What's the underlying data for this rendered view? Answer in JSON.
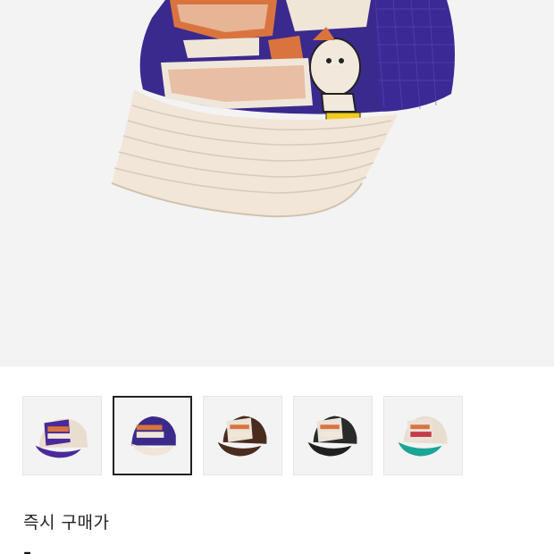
{
  "product": {
    "hero_image": "trucker-cap-purple-cream-graffiti",
    "price_label": "즉시 구매가",
    "price_value": "-"
  },
  "thumbnails": [
    {
      "name": "purple-cream-cap",
      "crown": "#4a2a9a",
      "front": "#e9ddd0",
      "brim": "#4a2a9a",
      "selected": false
    },
    {
      "name": "navy-cream-cap",
      "crown": "#3b2a8a",
      "front": "#e9ddd0",
      "brim": "#efe5d8",
      "selected": true
    },
    {
      "name": "brown-cap",
      "crown": "#4a2c1e",
      "front": "#ece3d7",
      "brim": "#4a2c1e",
      "selected": false
    },
    {
      "name": "black-cap",
      "crown": "#2a2a2a",
      "front": "#ebe3d8",
      "brim": "#1f1f1f",
      "selected": false
    },
    {
      "name": "teal-cap",
      "crown": "#e9ddd0",
      "front": "#ebe3d8",
      "brim": "#1aa596",
      "selected": false
    }
  ],
  "colors": {
    "hero_bg": "#f3f3f4",
    "cap_purple": "#3a2a8e",
    "brim_cream": "#f1e6d8",
    "graffiti_orange": "#d9743f"
  }
}
